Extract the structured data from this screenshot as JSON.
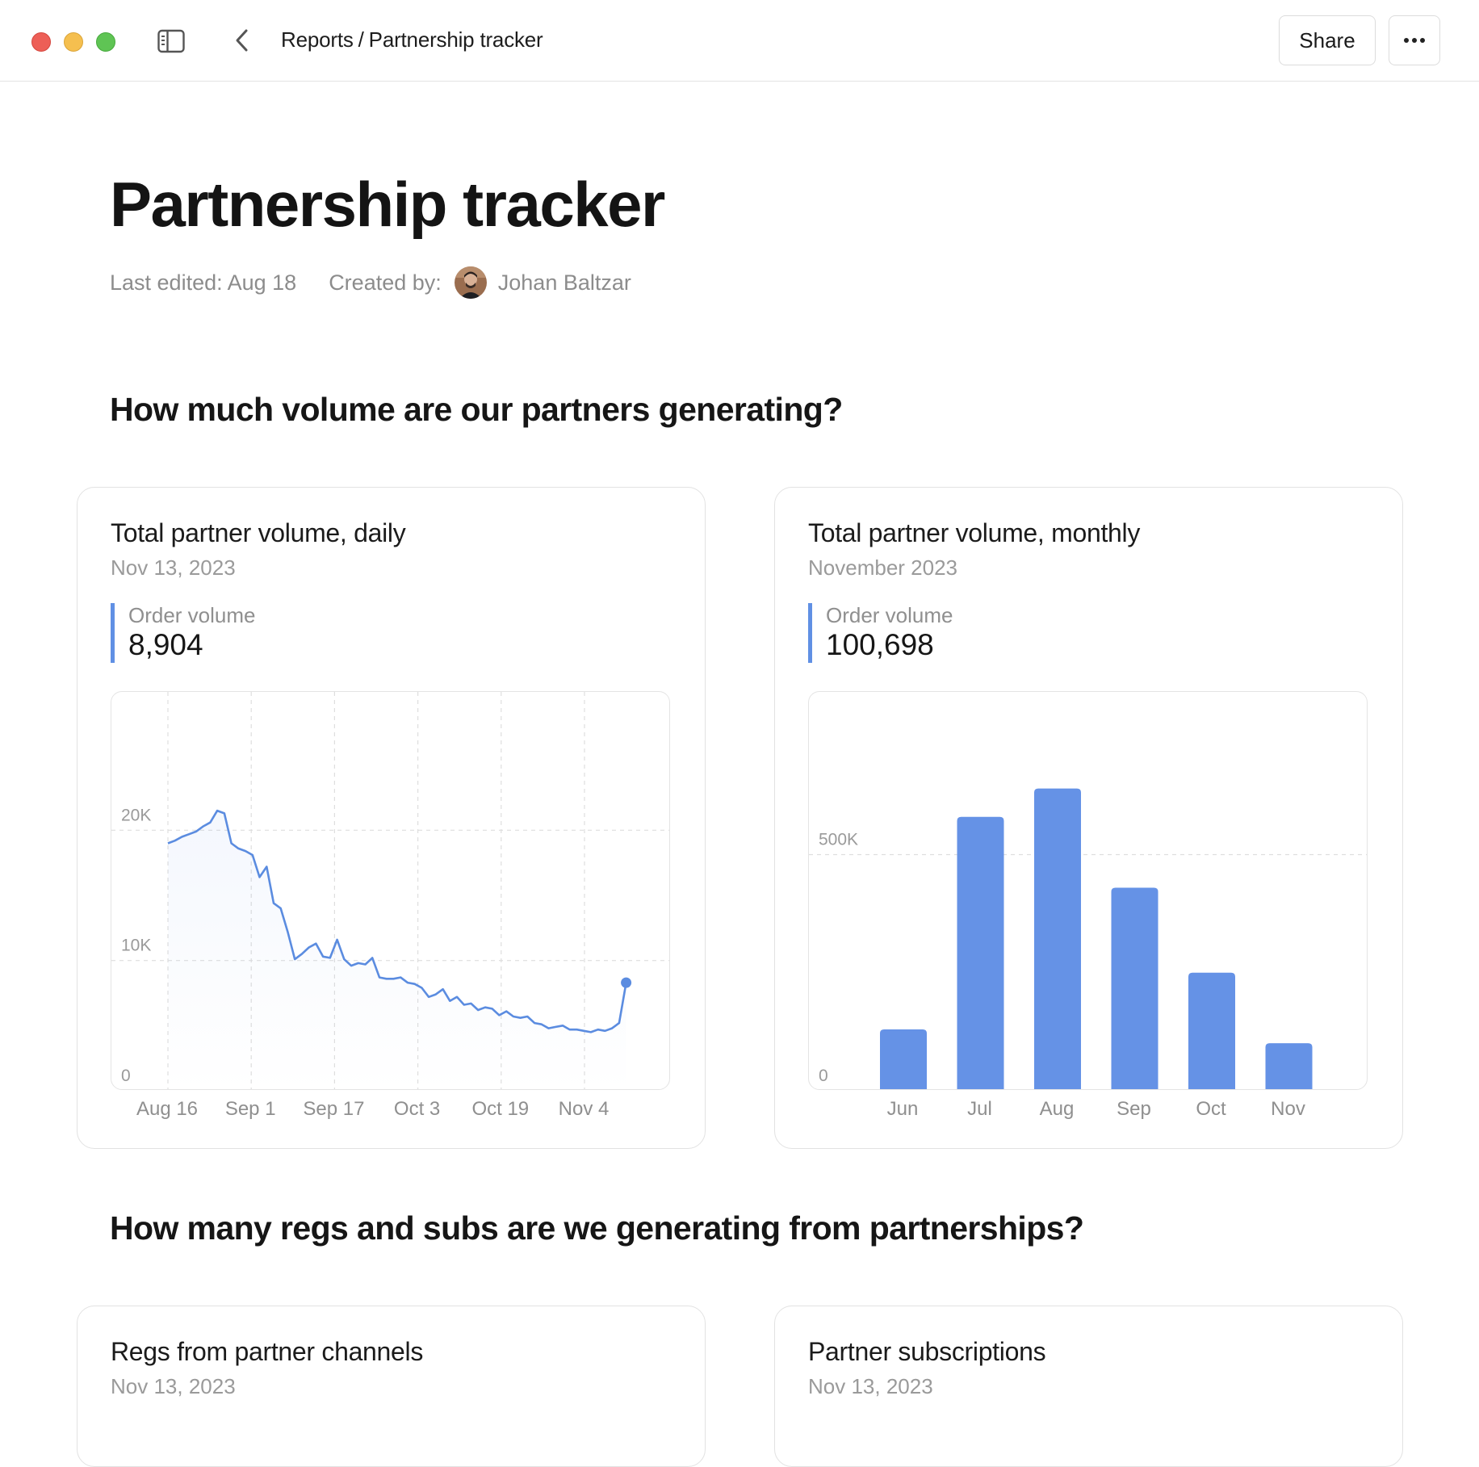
{
  "breadcrumb": {
    "parent": "Reports",
    "separator": "/",
    "current": "Partnership tracker"
  },
  "toolbar": {
    "share_label": "Share",
    "more_icon": "ellipsis-horizontal-icon"
  },
  "page": {
    "title": "Partnership tracker",
    "last_edited": "Last edited: Aug 18",
    "created_by_label": "Created by:",
    "author": "Johan Baltzar"
  },
  "sections": [
    {
      "title": "How much volume are our partners generating?"
    },
    {
      "title": "How many regs and subs are we generating from partnerships?"
    }
  ],
  "cards": {
    "daily": {
      "title": "Total partner volume, daily",
      "subtitle": "Nov 13, 2023",
      "kpi_label": "Order volume",
      "kpi_value": "8,904"
    },
    "monthly": {
      "title": "Total partner volume, monthly",
      "subtitle": "November 2023",
      "kpi_label": "Order volume",
      "kpi_value": "100,698"
    },
    "regs": {
      "title": "Regs from partner channels",
      "subtitle": "Nov 13, 2023"
    },
    "subs": {
      "title": "Partner subscriptions",
      "subtitle": "Nov 13, 2023"
    }
  },
  "colors": {
    "accent": "#6592e6",
    "accent_line": "#5b8ce0",
    "grid": "#dedede",
    "muted": "#8f8f8f"
  },
  "chart_data": [
    {
      "type": "line",
      "ylim": [
        0,
        30000
      ],
      "yticks": [
        0,
        10000,
        20000
      ],
      "ytick_labels": [
        "0",
        "10K",
        "20K"
      ],
      "xtick_labels": [
        "Aug 16",
        "Sep 1",
        "Sep 17",
        "Oct 3",
        "Oct 19",
        "Nov 4"
      ],
      "xtick_days": [
        0,
        16,
        32,
        48,
        64,
        80
      ],
      "grid": true,
      "series": [
        {
          "x_days": [
            0,
            1,
            2,
            3,
            4,
            5,
            6,
            7,
            8,
            9,
            10,
            11,
            12,
            13,
            14,
            15,
            16,
            17,
            18,
            19,
            20,
            21,
            22,
            23,
            24,
            25,
            26,
            27,
            28,
            29,
            30,
            31,
            32,
            33,
            34,
            35,
            36,
            37,
            38,
            39,
            40,
            41,
            42,
            43,
            44,
            45,
            46,
            47,
            48,
            49,
            50,
            51,
            52,
            53,
            54,
            55,
            56,
            57,
            58,
            59,
            60,
            61,
            62,
            63,
            64,
            65,
            66,
            67,
            68,
            69,
            70,
            71,
            72,
            73,
            74,
            75,
            76,
            77,
            78,
            79,
            80,
            81,
            82,
            83,
            84,
            85,
            86,
            87,
            88
          ],
          "values": [
            19000,
            19200,
            19500,
            19700,
            19900,
            20300,
            20600,
            21500,
            21300,
            19000,
            18600,
            18400,
            18100,
            16400,
            17200,
            14400,
            14000,
            12200,
            10100,
            10500,
            11000,
            11300,
            10300,
            10200,
            11600,
            10100,
            9600,
            9800,
            9700,
            10200,
            8700,
            8600,
            8600,
            8700,
            8300,
            8200,
            7900,
            7200,
            7400,
            7800,
            6900,
            7200,
            6600,
            6700,
            6200,
            6400,
            6300,
            5800,
            6100,
            5700,
            5600,
            5700,
            5200,
            5100,
            4800,
            4900,
            5000,
            4700,
            4700,
            4600,
            4500,
            4700,
            4600,
            4800,
            5200,
            8300
          ]
        }
      ]
    },
    {
      "type": "bar",
      "categories": [
        "Jun",
        "Jul",
        "Aug",
        "Sep",
        "Oct",
        "Nov"
      ],
      "values": [
        130000,
        580000,
        640000,
        430000,
        250000,
        100698
      ],
      "ylim": [
        0,
        800000
      ],
      "yticks": [
        0,
        500000
      ],
      "ytick_labels": [
        "0",
        "500K"
      ],
      "grid": true
    }
  ]
}
